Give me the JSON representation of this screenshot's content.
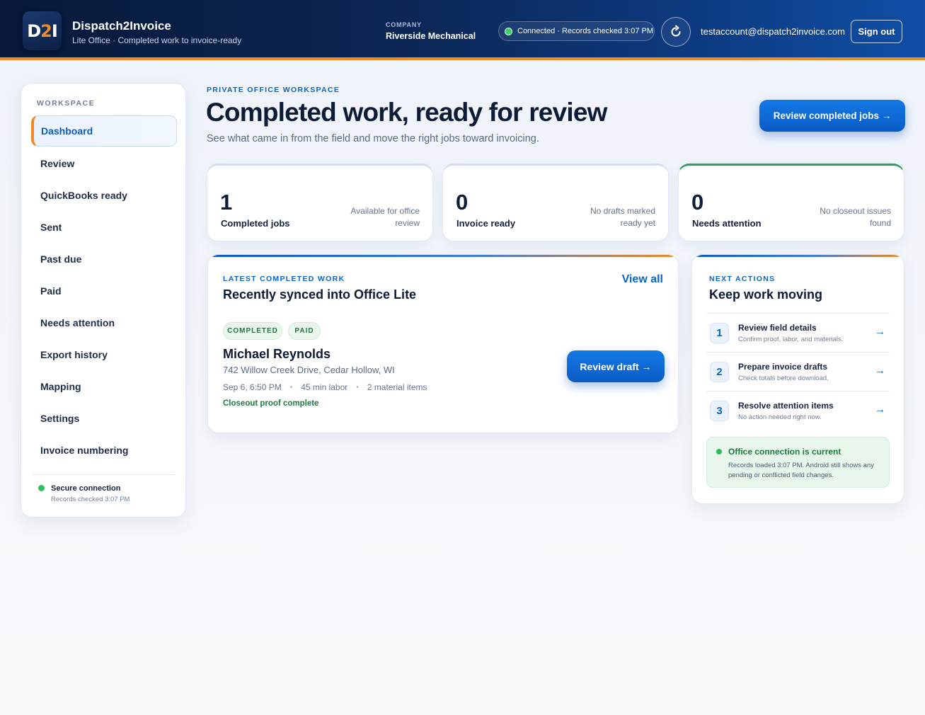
{
  "header": {
    "logo_text_1": "D",
    "logo_text_2": "2",
    "logo_text_3": "I",
    "app_title": "Dispatch2Invoice",
    "app_subtitle": "Lite Office · Completed work to invoice-ready",
    "company_label": "COMPANY",
    "company_name": "Riverside Mechanical",
    "status_text": "Connected · Records checked 3:07 PM",
    "refresh_icon": "refresh-icon",
    "user_email": "testaccount@dispatch2invoice.com",
    "sign_out_label": "Sign out"
  },
  "sidebar": {
    "heading": "WORKSPACE",
    "items": [
      {
        "label": "Dashboard",
        "active": true
      },
      {
        "label": "Review"
      },
      {
        "label": "QuickBooks ready"
      },
      {
        "label": "Sent"
      },
      {
        "label": "Past due"
      },
      {
        "label": "Paid"
      },
      {
        "label": "Needs attention"
      },
      {
        "label": "Export history"
      },
      {
        "label": "Mapping"
      },
      {
        "label": "Settings"
      },
      {
        "label": "Invoice numbering"
      }
    ],
    "secure_title": "Secure connection",
    "secure_sub": "Records checked 3:07 PM"
  },
  "main": {
    "eyebrow": "PRIVATE OFFICE WORKSPACE",
    "title": "Completed work, ready for review",
    "subtitle": "See what came in from the field and move the right jobs toward invoicing.",
    "primary_button": "Review completed jobs →"
  },
  "stats": [
    {
      "value": "1",
      "label": "Completed jobs",
      "note": "Available for office review"
    },
    {
      "value": "0",
      "label": "Invoice ready",
      "note": "No drafts marked ready yet"
    },
    {
      "value": "0",
      "label": "Needs attention",
      "note": "No closeout issues found"
    }
  ],
  "latest": {
    "eyebrow": "LATEST COMPLETED WORK",
    "title": "Recently synced into Office Lite",
    "view_all": "View all",
    "badges": [
      "COMPLETED",
      "PAID"
    ],
    "client_name": "Michael Reynolds",
    "address": "742 Willow Creek Drive, Cedar Hollow, WI",
    "meta": [
      "Sep 6, 6:50 PM",
      "45 min labor",
      "2 material items"
    ],
    "meta_sep": "•",
    "proof": "Closeout proof complete",
    "button": "Review draft →"
  },
  "next_actions": {
    "eyebrow": "NEXT ACTIONS",
    "title": "Keep work moving",
    "items": [
      {
        "num": "1",
        "title": "Review field details",
        "sub": "Confirm proof, labor, and materials.",
        "arrow": "→"
      },
      {
        "num": "2",
        "title": "Prepare invoice drafts",
        "sub": "Check totals before download.",
        "arrow": "→"
      },
      {
        "num": "3",
        "title": "Resolve attention items",
        "sub": "No action needed right now.",
        "arrow": "→"
      }
    ],
    "connection_title": "Office connection is current",
    "connection_text": "Records loaded 3:07 PM. Android still shows any pending or conflicted field changes."
  },
  "colors": {
    "accent": "#0b64c8",
    "brand_orange": "#f08a24",
    "success": "#1f7a3f",
    "header_dark": "#071838"
  }
}
